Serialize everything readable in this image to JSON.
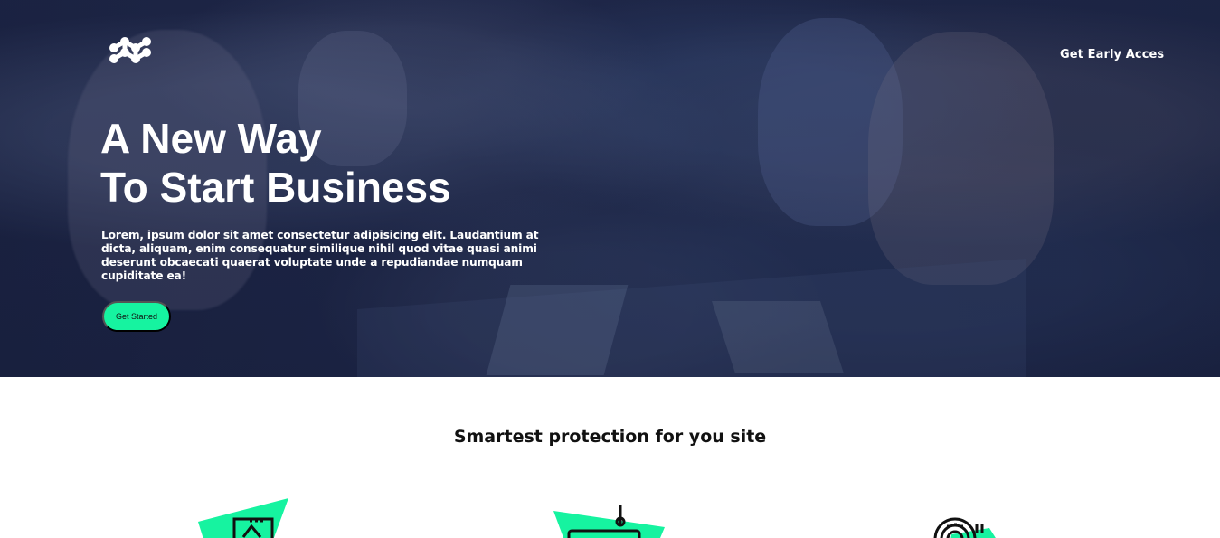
{
  "header": {
    "logo_icon": "network-logo-icon",
    "nav_cta_label": "Get Early Acces"
  },
  "hero": {
    "title_line_1": "A New Way",
    "title_line_2": "To Start Business",
    "description": "Lorem, ipsum dolor sit amet consectetur adipisicing elit. Laudantium at dicta, aliquam, enim consequatur similique nihil quod vitae quasi animi deserunt obcaecati quaerat voluptate unde a repudiandae numquam cupiditate ea!",
    "button_label": "Get Started"
  },
  "features": {
    "title": "Smartest protection for you site",
    "icons": [
      "monitor-icon",
      "router-icon",
      "fingerprint-icon"
    ]
  },
  "colors": {
    "hero_background": "#1e2647",
    "accent": "#16f3a0",
    "text_light": "#ffffff",
    "text_dark": "#111111"
  }
}
